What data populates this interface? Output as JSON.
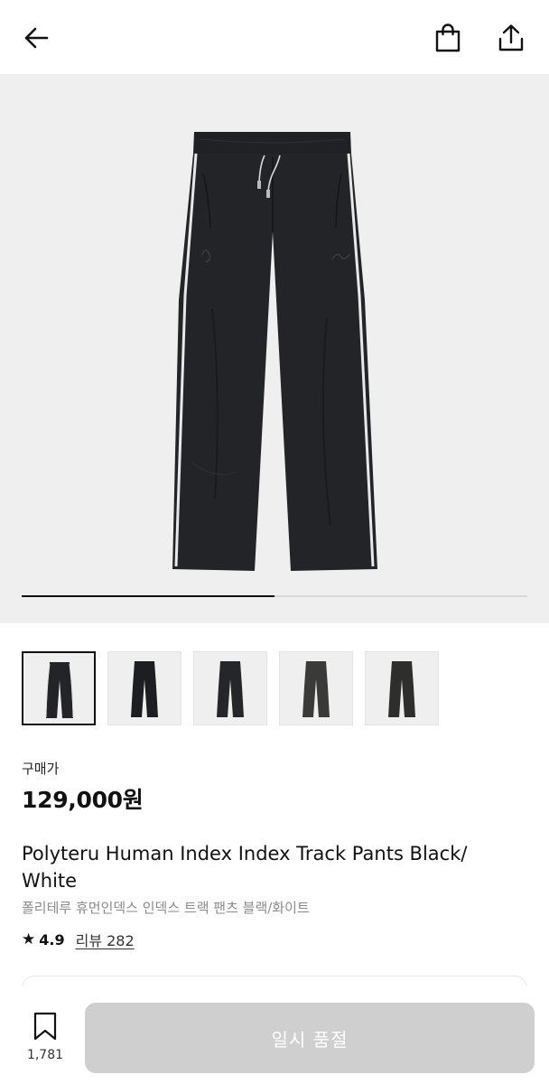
{
  "header": {
    "back_icon": "back-arrow-icon",
    "bag_icon": "shopping-bag-icon",
    "share_icon": "share-icon"
  },
  "gallery": {
    "current_index": 1,
    "total": 2,
    "progress_fraction": 0.5,
    "thumbnails": [
      {
        "name": "thumbnail-1",
        "active": true
      },
      {
        "name": "thumbnail-2",
        "active": false
      },
      {
        "name": "thumbnail-3",
        "active": false
      },
      {
        "name": "thumbnail-4",
        "active": false
      },
      {
        "name": "thumbnail-5",
        "active": false
      }
    ]
  },
  "product": {
    "price_label": "구매가",
    "price": "129,000원",
    "title_en": "Polyteru Human Index Index Track Pants Black/ White",
    "title_ko": "폴리테루 휴먼인덱스 인덱스 트랙 팬츠 블랙/화이트",
    "rating": "4.9",
    "review_link": "리뷰 282"
  },
  "bottom": {
    "wish_count": "1,781",
    "cta_label": "일시 품절"
  },
  "colors": {
    "pants": "#232427",
    "hero_bg": "#efefef",
    "cta_disabled": "#cfcfcf"
  }
}
